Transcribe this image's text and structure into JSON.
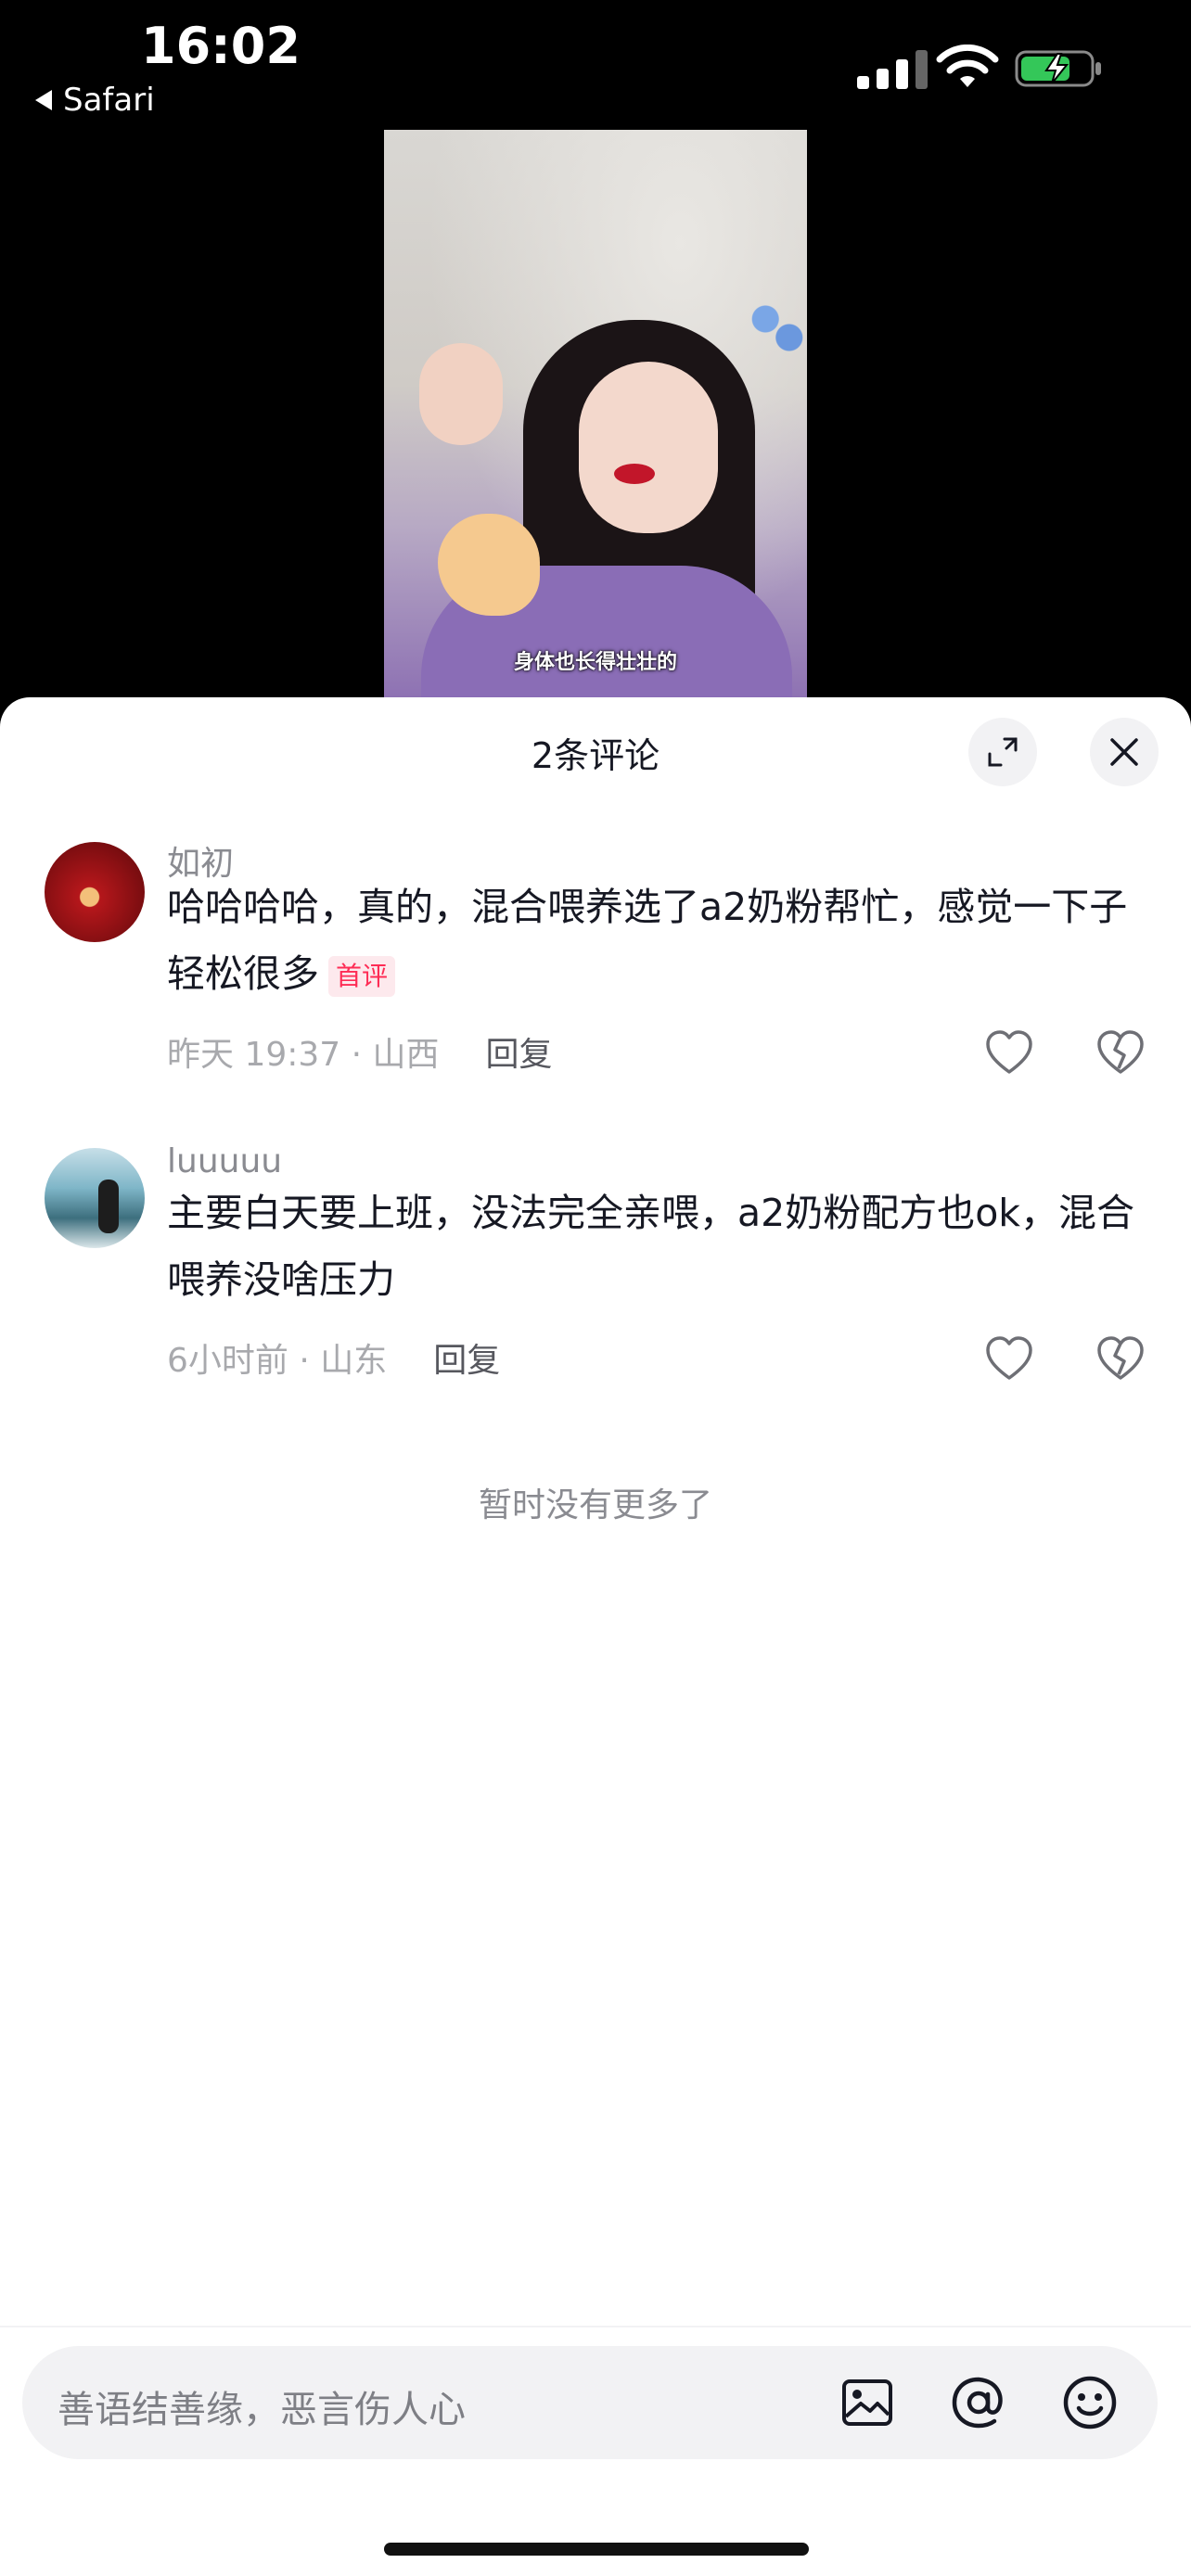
{
  "status_bar": {
    "time": "16:02",
    "back_app": "Safari"
  },
  "video": {
    "caption": "身体也长得壮壮的"
  },
  "sheet": {
    "title": "2条评论"
  },
  "comments": [
    {
      "username": "如初",
      "text": "哈哈哈哈，真的，混合喂养选了a2奶粉帮忙，感觉一下子轻松很多",
      "badge": "首评",
      "time_location": "昨天 19:37 · 山西",
      "reply_label": "回复"
    },
    {
      "username": "luuuuu",
      "text": "主要白天要上班，没法完全亲喂，a2奶粉配方也ok，混合喂养没啥压力",
      "time_location": "6小时前 · 山东",
      "reply_label": "回复"
    }
  ],
  "no_more_text": "暂时没有更多了",
  "input": {
    "placeholder": "善语结善缘，恶言伤人心"
  },
  "icons": {
    "expand": "expand-icon",
    "close": "close-icon",
    "like": "heart-outline-icon",
    "dislike": "broken-heart-icon",
    "image": "image-icon",
    "mention": "at-icon",
    "emoji": "emoji-icon"
  },
  "colors": {
    "accent": "#fe2c55",
    "text_primary": "#161823",
    "text_secondary": "#8a8b91"
  }
}
